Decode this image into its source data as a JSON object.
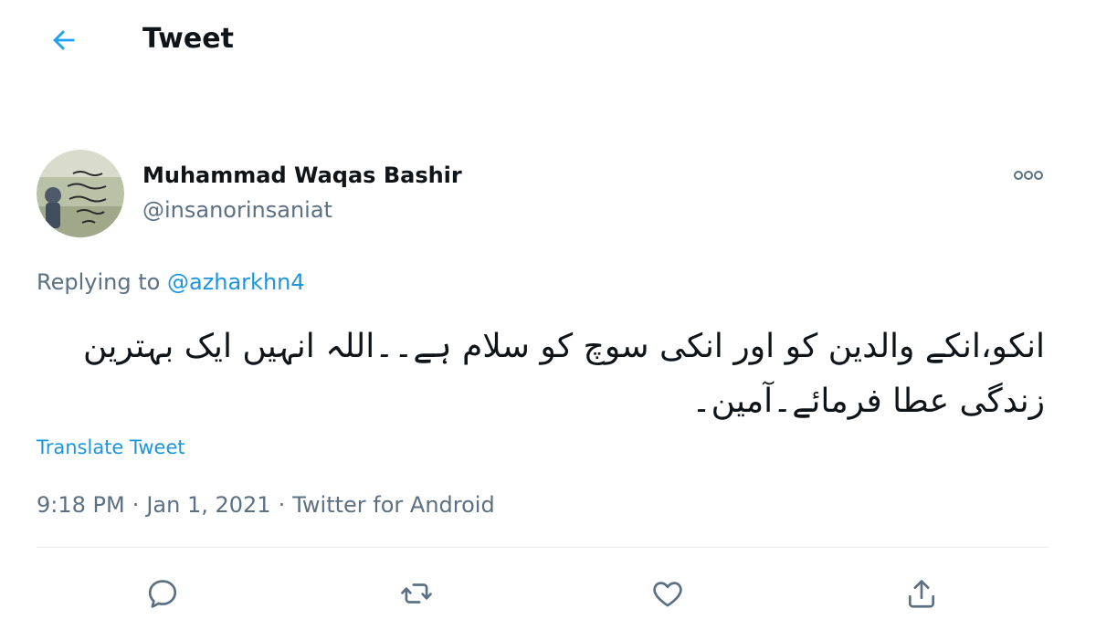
{
  "header": {
    "title": "Tweet",
    "back_icon": "arrow-left-icon",
    "accent_color": "#1da1f2"
  },
  "author": {
    "name": "Muhammad Waqas Bashir",
    "handle": "@insanorinsaniat",
    "avatar_icon": "profile-avatar"
  },
  "more_icon": "more-options-icon",
  "reply_context": {
    "prefix": "Replying to",
    "mention": "@azharkhn4",
    "mention_color": "#1b95e0"
  },
  "tweet": {
    "text": "انکو،انکے والدین کو اور انکی سوچ کو سلام ہے۔۔اللہ انہیں ایک بہترین زندگی عطا فرمائے۔آمین۔",
    "translate_label": "Translate Tweet"
  },
  "meta": {
    "time": "9:18 PM",
    "date": "Jan 1, 2021",
    "source": "Twitter for Android",
    "separator": "·",
    "text_color": "#5b7083"
  },
  "actions": [
    {
      "icon": "reply-icon"
    },
    {
      "icon": "retweet-icon"
    },
    {
      "icon": "like-icon"
    },
    {
      "icon": "share-icon"
    }
  ]
}
